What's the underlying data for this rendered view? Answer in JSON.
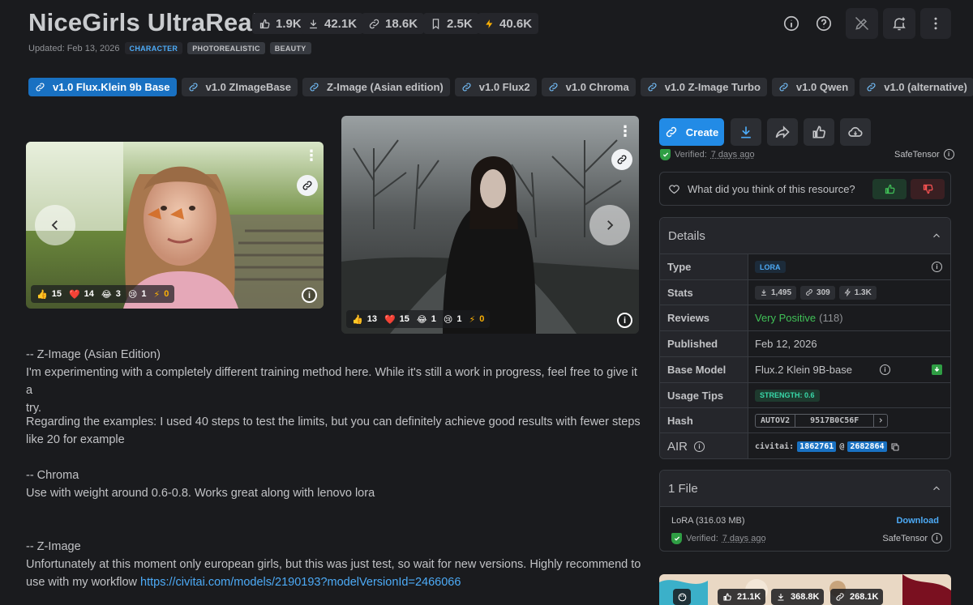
{
  "header": {
    "title": "NiceGirls UltraReal",
    "stats": [
      {
        "icon": "thumb-up-icon",
        "value": "1.9K"
      },
      {
        "icon": "download-icon",
        "value": "42.1K"
      },
      {
        "icon": "link-icon",
        "value": "18.6K"
      },
      {
        "icon": "bookmark-icon",
        "value": "2.5K"
      },
      {
        "icon": "bolt-icon",
        "value": "40.6K"
      }
    ],
    "updated": "Updated: Feb 13, 2026",
    "tags": [
      "CHARACTER",
      "PHOTOREALISTIC",
      "BEAUTY"
    ]
  },
  "versions": [
    "v1.0 Flux.Klein 9b Base",
    "v1.0 ZImageBase",
    "Z-Image (Asian edition)",
    "v1.0 Flux2",
    "v1.0 Chroma",
    "v1.0 Z-Image Turbo",
    "v1.0 Qwen",
    "v1.0 (alternative)"
  ],
  "gallery": {
    "image1_reactions": {
      "like": "15",
      "heart": "14",
      "laugh": "3",
      "cry": "1",
      "bolt": "0"
    },
    "image2_reactions": {
      "like": "13",
      "heart": "15",
      "laugh": "1",
      "cry": "1",
      "bolt": "0"
    }
  },
  "description": {
    "p1_line1": "-- Z-Image (Asian Edition)",
    "p1_line2": "I'm experimenting with a completely different training method here. While it's still a work in progress, feel free to give it a",
    "p1_line3": "try.",
    "p2_line1": "Regarding the examples: I used 40 steps to test the limits, but you can definitely achieve good results with fewer steps",
    "p2_line2": "like 20 for example",
    "p3_line1": "-- Chroma",
    "p3_line2": "Use with weight around 0.6-0.8. Works great along with lenovo lora",
    "p4_line1": "-- Z-Image",
    "p4_line2": "Unfortunately at this moment only european girls, but this was just test, so wait for new versions. Highly recommend to",
    "p4_line3_prefix": "use with my workflow ",
    "p4_link": "https://civitai.com/models/2190193?modelVersionId=2466066"
  },
  "actions": {
    "create_label": "Create",
    "verified_prefix": "Verified:",
    "verified_when": "7 days ago",
    "format": "SafeTensor"
  },
  "feedback": {
    "question": "What did you think of this resource?"
  },
  "details": {
    "title": "Details",
    "type_label": "Type",
    "type_value": "LORA",
    "stats_label": "Stats",
    "stats_downloads": "1,495",
    "stats_links": "309",
    "stats_bolt": "1.3K",
    "reviews_label": "Reviews",
    "reviews_value": "Very Positive",
    "reviews_count": "(118)",
    "published_label": "Published",
    "published_value": "Feb 12, 2026",
    "base_label": "Base Model",
    "base_value": "Flux.2 Klein 9B-base",
    "tips_label": "Usage Tips",
    "tips_value": "STRENGTH: 0.6",
    "hash_label": "Hash",
    "hash_type": "AUTOV2",
    "hash_value": "9517B0C56F",
    "air_label": "AIR",
    "air_prefix": "civitai:",
    "air_model": "1862761",
    "air_at": "@",
    "air_version": "2682864"
  },
  "files": {
    "title": "1 File",
    "file_name": "LoRA (316.03 MB)",
    "download": "Download",
    "verified_prefix": "Verified:",
    "verified_when": "7 days ago",
    "format": "SafeTensor"
  },
  "related": {
    "likes": "21.1K",
    "downloads": "368.8K",
    "links": "268.1K"
  },
  "colors": {
    "accent": "#228be6",
    "background": "#1a1b1e",
    "panel": "#25262b",
    "positive": "#40c057"
  }
}
